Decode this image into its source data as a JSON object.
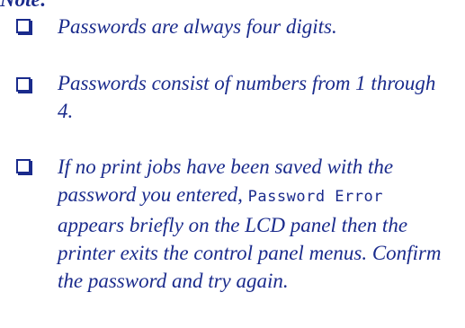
{
  "note": {
    "heading": "Note:",
    "items": [
      {
        "text": "Passwords are always four digits."
      },
      {
        "text": "Passwords consist of numbers from 1 through 4."
      },
      {
        "text_before": "If no print jobs have been saved with the password you entered, ",
        "lcd_message": "Password Error",
        "text_after": " appears briefly on the LCD panel then the printer exits the control panel menus. Confirm the password and try again."
      }
    ]
  },
  "colors": {
    "text": "#1a2b8c",
    "background": "#ffffff"
  },
  "icons": {
    "bullet": "checkbox-icon"
  }
}
